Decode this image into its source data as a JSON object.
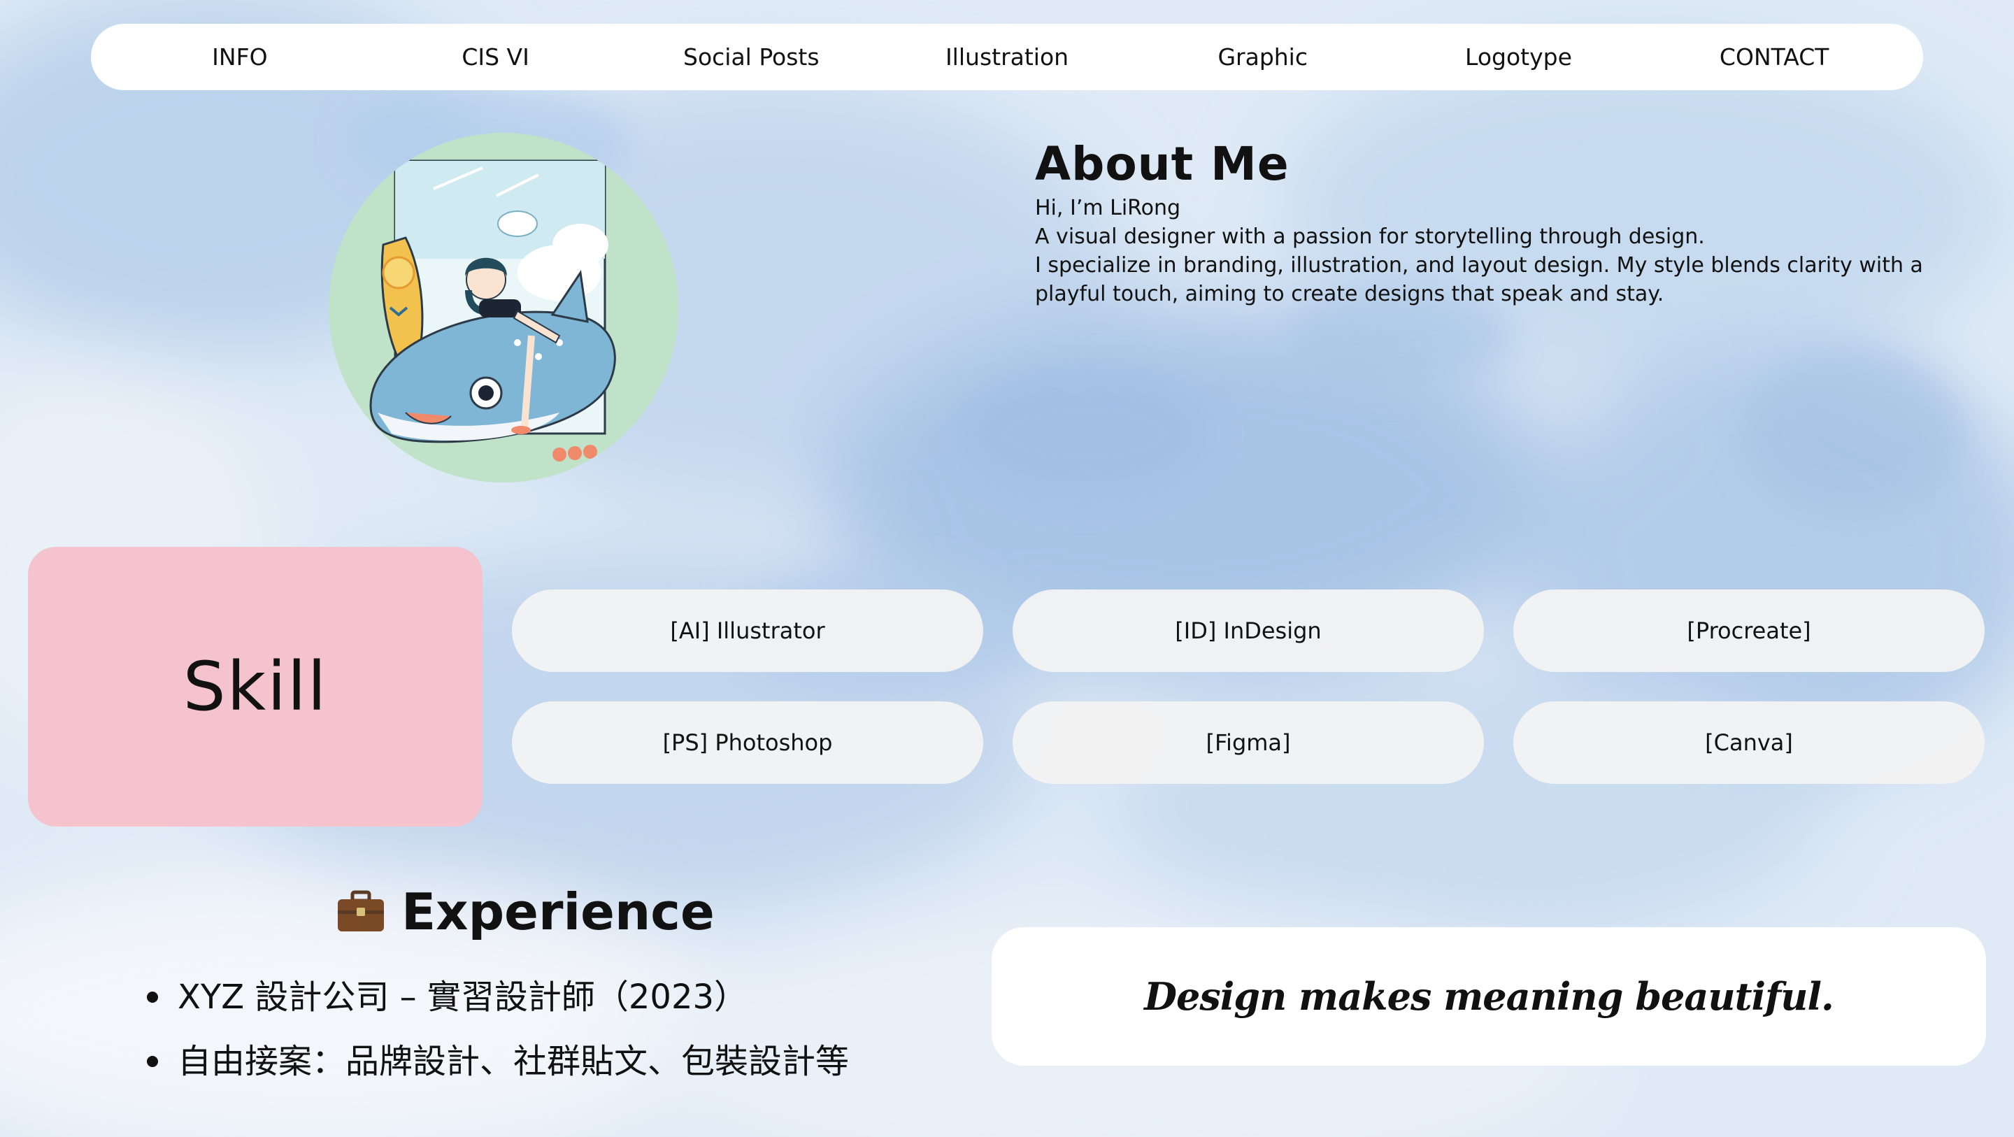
{
  "nav": {
    "items": [
      {
        "label": "INFO"
      },
      {
        "label": "CIS VI"
      },
      {
        "label": "Social Posts"
      },
      {
        "label": "Illustration"
      },
      {
        "label": "Graphic"
      },
      {
        "label": "Logotype"
      },
      {
        "label": "CONTACT"
      }
    ]
  },
  "avatar": {
    "icon": "illustration-girl-on-whale-shark"
  },
  "about": {
    "title": "About Me",
    "lines": [
      "Hi, I’m LiRong",
      "A visual designer with a passion for storytelling through design.",
      "I specialize in branding, illustration, and layout design. My style blends clarity with a",
      "playful touch, aiming to create designs that speak and stay."
    ]
  },
  "skill": {
    "title": "Skill",
    "color": "#f4c3cd",
    "items": [
      {
        "label": "[AI] Illustrator"
      },
      {
        "label": "[ID] InDesign"
      },
      {
        "label": "[Procreate]"
      },
      {
        "label": "[PS] Photoshop"
      },
      {
        "label": "[Figma]"
      },
      {
        "label": "[Canva]"
      }
    ]
  },
  "experience": {
    "icon": "briefcase-icon",
    "title": "Experience",
    "items": [
      {
        "text": "XYZ 設計公司 – 實習設計師（2023）"
      },
      {
        "text": "自由接案：品牌設計、社群貼文、包裝設計等"
      }
    ]
  },
  "quote": {
    "text": "Design makes meaning beautiful."
  }
}
